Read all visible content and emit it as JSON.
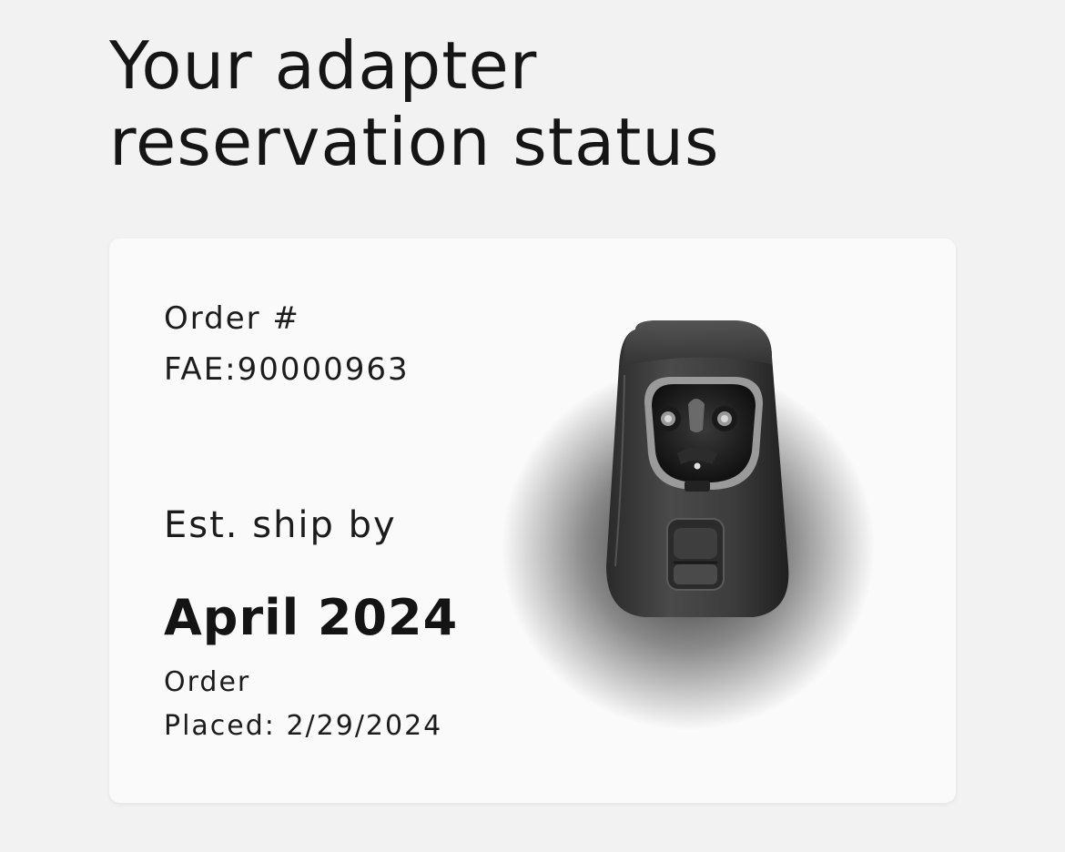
{
  "page": {
    "title_line1": "Your adapter",
    "title_line2": "reservation status"
  },
  "order": {
    "number_label": "Order #",
    "number": "FAE:90000963",
    "ship_label": "Est. ship by",
    "ship_date": "April 2024",
    "placed_label": "Order",
    "placed_text": "Placed: 2/29/2024"
  },
  "product": {
    "image_icon": "charging-adapter-icon",
    "color": "#3a3a3a"
  }
}
